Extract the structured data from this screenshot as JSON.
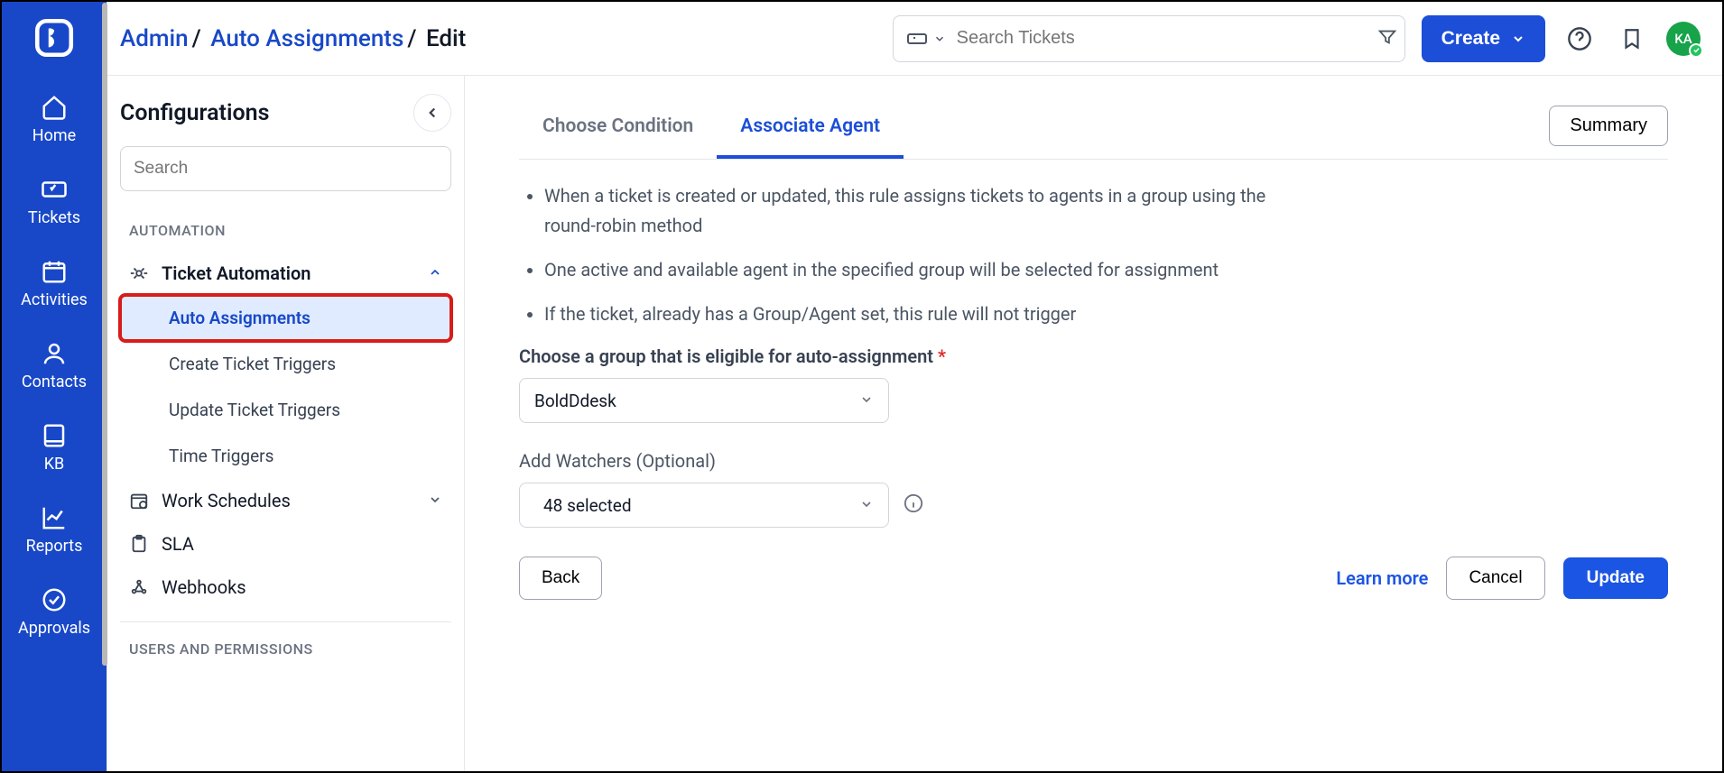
{
  "breadcrumb": {
    "admin": "Admin",
    "section": "Auto Assignments",
    "current": "Edit"
  },
  "search": {
    "placeholder": "Search Tickets"
  },
  "topbar": {
    "createLabel": "Create",
    "avatarInitials": "KA"
  },
  "rail": {
    "items": [
      {
        "label": "Home"
      },
      {
        "label": "Tickets"
      },
      {
        "label": "Activities"
      },
      {
        "label": "Contacts"
      },
      {
        "label": "KB"
      },
      {
        "label": "Reports"
      },
      {
        "label": "Approvals"
      }
    ]
  },
  "panel": {
    "title": "Configurations",
    "searchPlaceholder": "Search",
    "sectionAutomation": "AUTOMATION",
    "ticketAutomation": "Ticket Automation",
    "subs": {
      "autoAssignments": "Auto Assignments",
      "createTriggers": "Create Ticket Triggers",
      "updateTriggers": "Update Ticket Triggers",
      "timeTriggers": "Time Triggers"
    },
    "workSchedules": "Work Schedules",
    "sla": "SLA",
    "webhooks": "Webhooks",
    "sectionUsers": "USERS AND PERMISSIONS"
  },
  "content": {
    "tabs": {
      "choose": "Choose Condition",
      "associate": "Associate Agent"
    },
    "summaryBtn": "Summary",
    "bullets": [
      "When a ticket is created or updated, this rule assigns tickets to agents in a group using the round-robin method",
      "One active and available agent in the specified group will be selected for assignment",
      "If the ticket, already has a Group/Agent set, this rule will not trigger"
    ],
    "groupLabel": "Choose a group that is eligible for auto-assignment",
    "groupValue": "BoldDdesk",
    "watchersLabel": "Add Watchers (Optional)",
    "watchersValue": "48 selected",
    "backBtn": "Back",
    "learnMore": "Learn more",
    "cancelBtn": "Cancel",
    "updateBtn": "Update"
  }
}
